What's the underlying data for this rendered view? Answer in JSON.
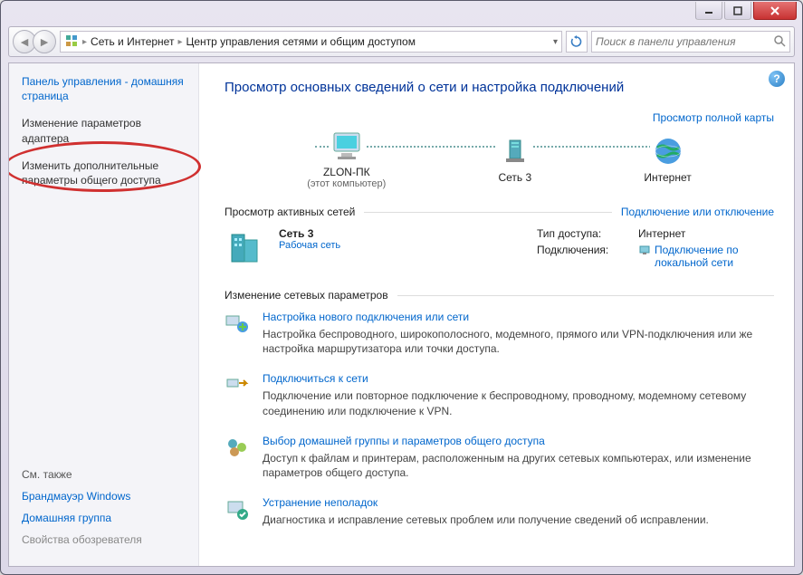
{
  "breadcrumb": {
    "item1": "Сеть и Интернет",
    "item2": "Центр управления сетями и общим доступом"
  },
  "search": {
    "placeholder": "Поиск в панели управления"
  },
  "sidebar": {
    "home": "Панель управления - домашняя страница",
    "adapter": "Изменение параметров адаптера",
    "sharing": "Изменить дополнительные параметры общего доступа",
    "seealso_label": "См. также",
    "firewall": "Брандмауэр Windows",
    "homegroup": "Домашняя группа",
    "browser": "Свойства обозревателя"
  },
  "heading": "Просмотр основных сведений о сети и настройка подключений",
  "map": {
    "full_map": "Просмотр полной карты",
    "pc_name": "ZLON-ПК",
    "pc_sub": "(этот компьютер)",
    "net_name": "Сеть 3",
    "inet_name": "Интернет"
  },
  "active": {
    "group_label": "Просмотр активных сетей",
    "connect_link": "Подключение или отключение",
    "name": "Сеть 3",
    "type": "Рабочая сеть",
    "access_lbl": "Тип доступа:",
    "access_val": "Интернет",
    "conn_lbl": "Подключения:",
    "conn_val": "Подключение по локальной сети"
  },
  "params": {
    "group_label": "Изменение сетевых параметров",
    "t1_title": "Настройка нового подключения или сети",
    "t1_desc": "Настройка беспроводного, широкополосного, модемного, прямого или VPN-подключения или же настройка маршрутизатора или точки доступа.",
    "t2_title": "Подключиться к сети",
    "t2_desc": "Подключение или повторное подключение к беспроводному, проводному, модемному сетевому соединению или подключение к VPN.",
    "t3_title": "Выбор домашней группы и параметров общего доступа",
    "t3_desc": "Доступ к файлам и принтерам, расположенным на других сетевых компьютерах, или изменение параметров общего доступа.",
    "t4_title": "Устранение неполадок",
    "t4_desc": "Диагностика и исправление сетевых проблем или получение сведений об исправлении."
  }
}
